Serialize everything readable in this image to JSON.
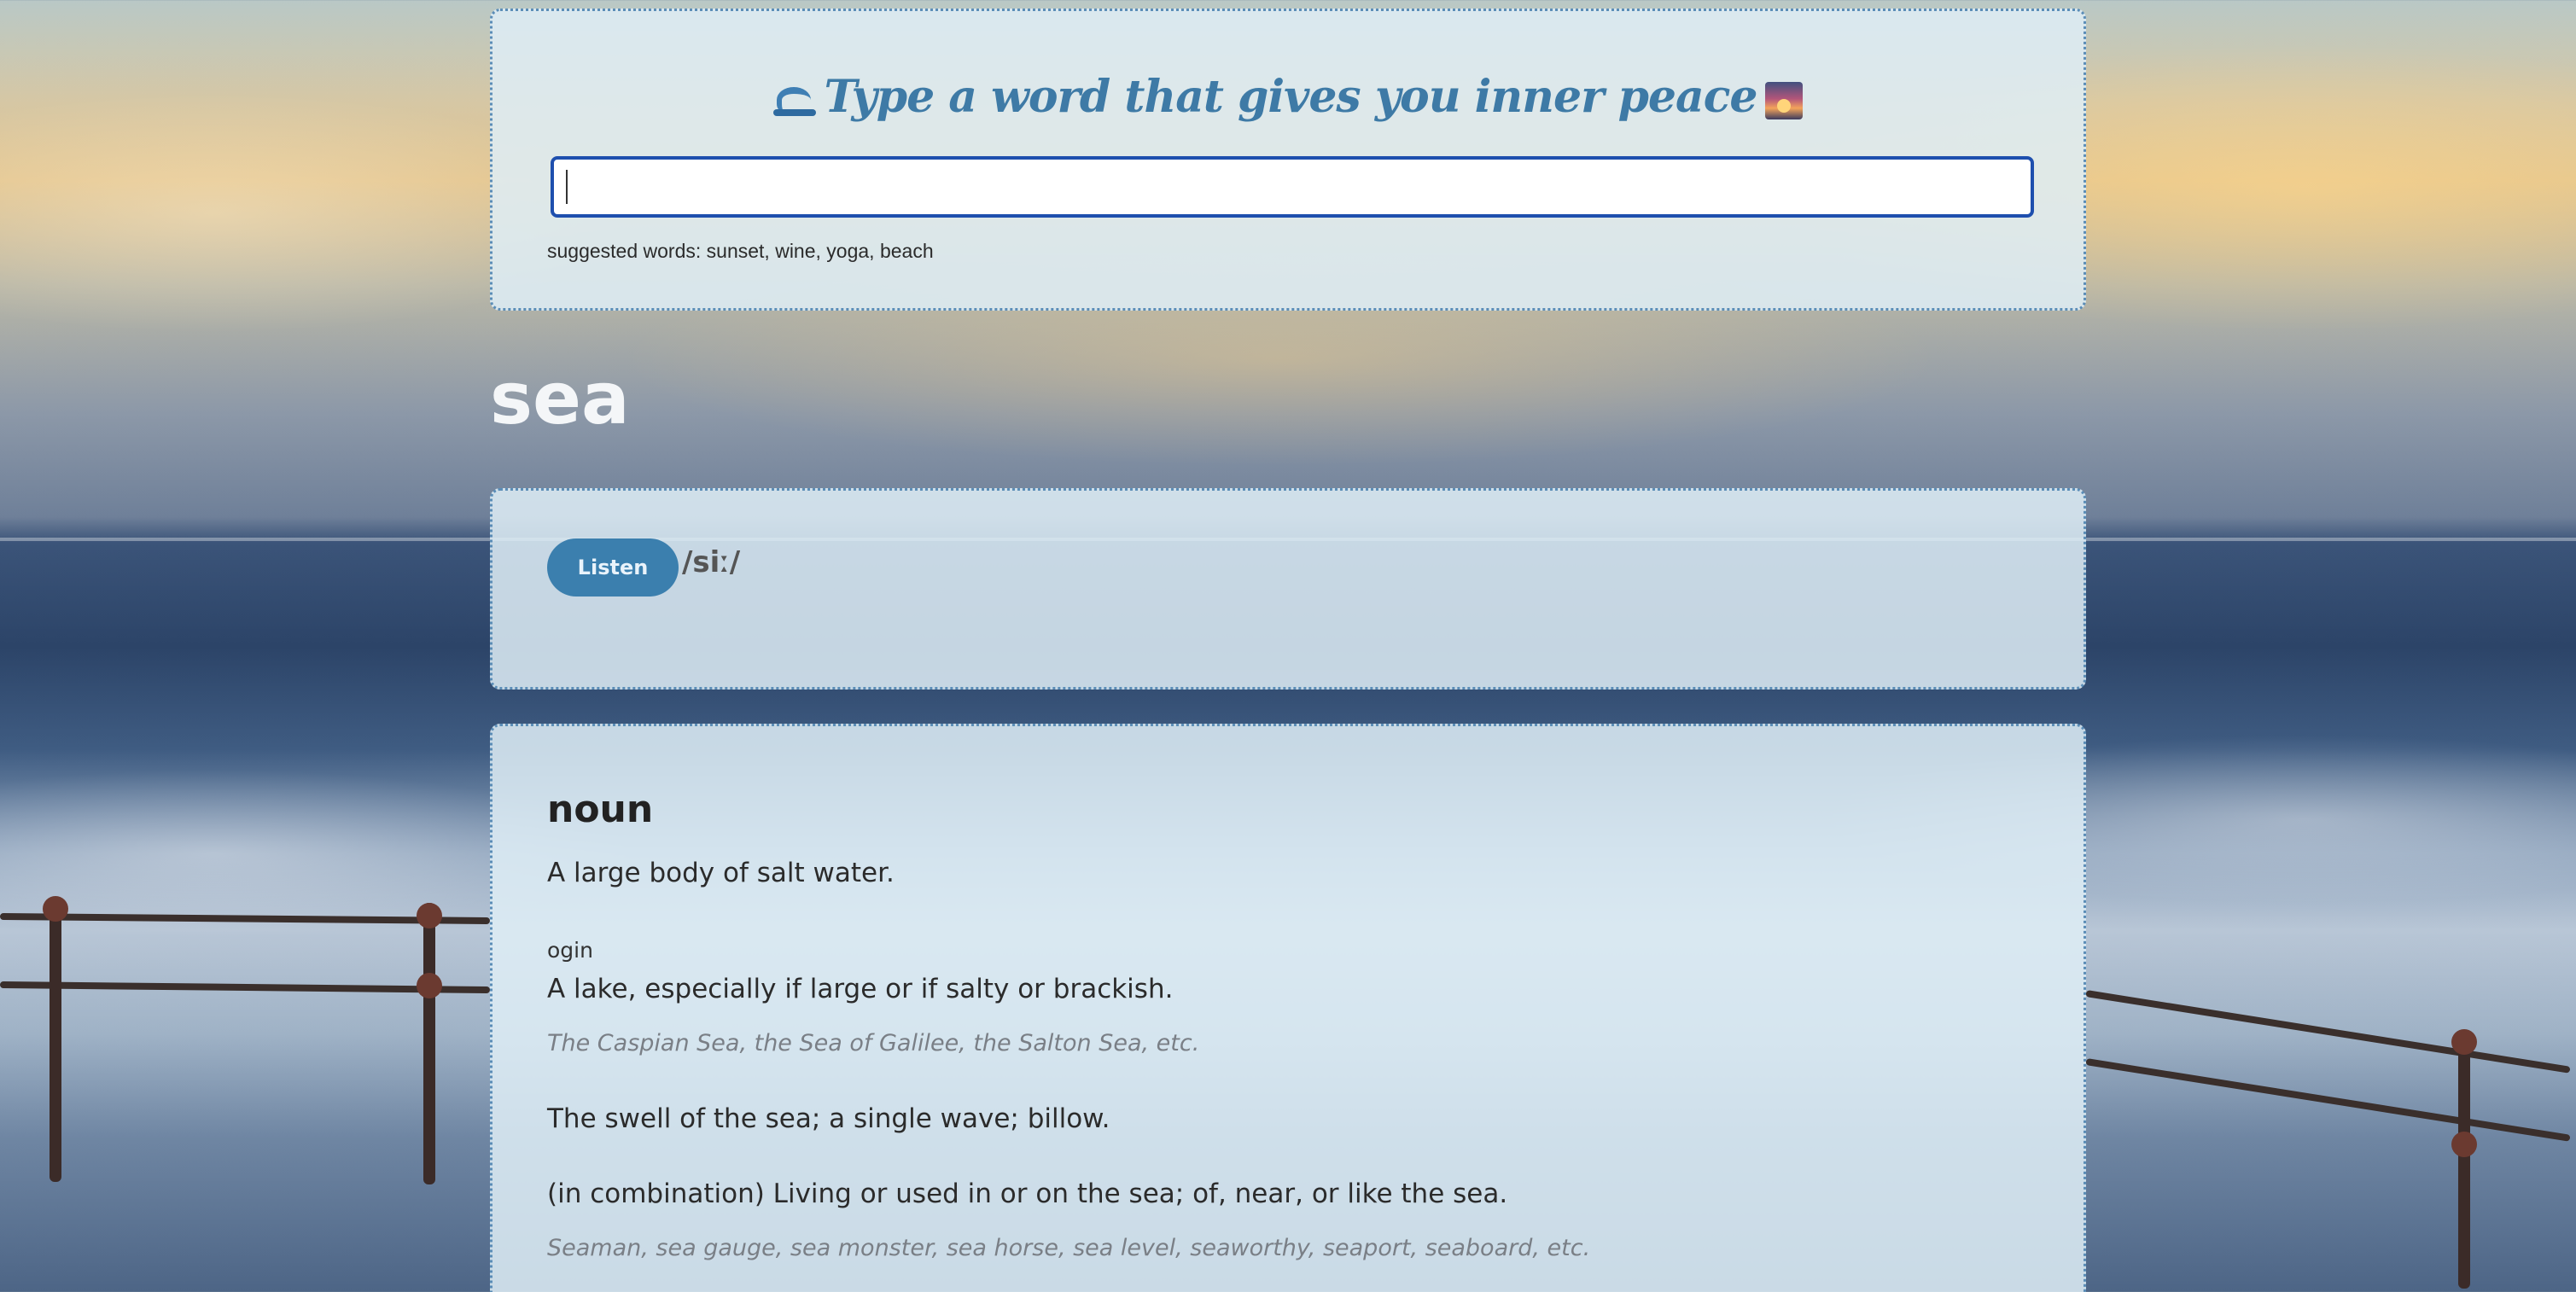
{
  "search": {
    "title": "Type a word that gives you inner peace",
    "left_icon": "wave-icon",
    "right_icon": "sunset-icon",
    "value": "",
    "suggestions": "suggested words: sunset, wine, yoga, beach"
  },
  "word": "sea",
  "phonetic": {
    "listen_label": "Listen",
    "text": "/siː/"
  },
  "meanings": [
    {
      "part_of_speech": "noun",
      "definitions": [
        {
          "text": "A large body of salt water."
        },
        {
          "origin": "ogin",
          "text": "A lake, especially if large or if salty or brackish.",
          "example": "The Caspian Sea, the Sea of Galilee, the Salton Sea, etc."
        },
        {
          "text": "The swell of the sea; a single wave; billow."
        },
        {
          "text": "(in combination) Living or used in or on the sea; of, near, or like the sea.",
          "example": "Seaman, sea gauge, sea monster, sea horse, sea level, seaworthy, seaport, seaboard, etc."
        }
      ]
    }
  ],
  "colors": {
    "accent": "#3b7fae",
    "title": "#3e7aa6",
    "input_border": "#1e4fae",
    "panel_border": "#5b8db7"
  }
}
